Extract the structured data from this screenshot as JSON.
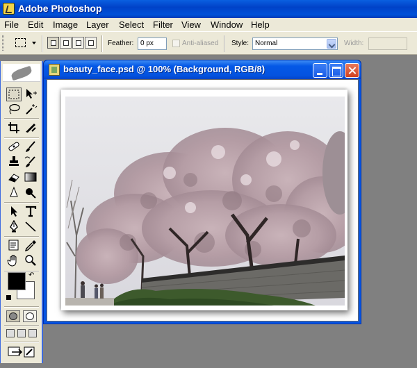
{
  "app": {
    "title": "Adobe Photoshop"
  },
  "menu": [
    "File",
    "Edit",
    "Image",
    "Layer",
    "Select",
    "Filter",
    "View",
    "Window",
    "Help"
  ],
  "options": {
    "feather_label": "Feather:",
    "feather_value": "0 px",
    "antialias_label": "Anti-aliased",
    "style_label": "Style:",
    "style_value": "Normal",
    "width_label": "Width:",
    "width_value": ""
  },
  "document": {
    "title": "beauty_face.psd @ 100% (Background, RGB/8)"
  },
  "tools": [
    "rectangular-marquee-tool",
    "move-tool",
    "lasso-tool",
    "magic-wand-tool",
    "crop-tool",
    "slice-tool",
    "healing-brush-tool",
    "brush-tool",
    "clone-stamp-tool",
    "history-brush-tool",
    "eraser-tool",
    "gradient-tool",
    "blur-tool",
    "dodge-tool",
    "path-selection-tool",
    "type-tool",
    "pen-tool",
    "line-tool",
    "notes-tool",
    "eyedropper-tool",
    "hand-tool",
    "zoom-tool"
  ],
  "colors": {
    "foreground": "#000000",
    "background": "#ffffff",
    "titlebar": "#0454e4",
    "workspace": "#808080"
  }
}
